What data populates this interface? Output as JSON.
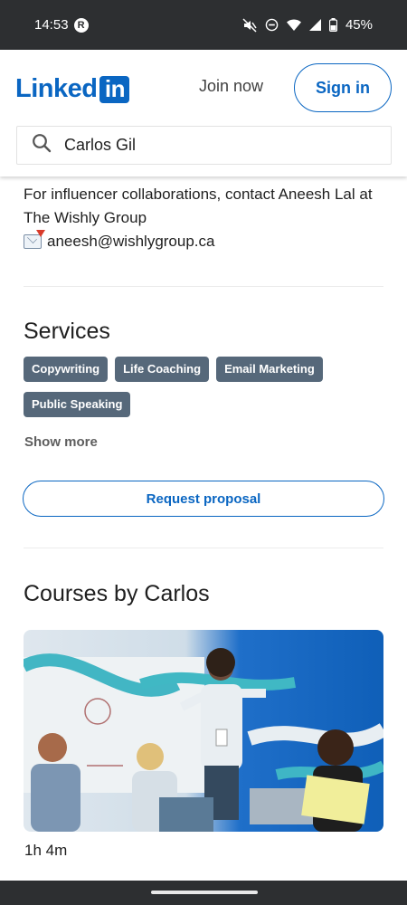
{
  "status_bar": {
    "time": "14:53",
    "badge": "R",
    "battery": "45%"
  },
  "header": {
    "logo_text": "Linked",
    "logo_badge": "in",
    "join_label": "Join now",
    "signin_label": "Sign in"
  },
  "search": {
    "value": "Carlos Gil",
    "icon": "search-icon"
  },
  "about": {
    "line1": "For influencer collaborations, contact Aneesh Lal at The Wishly Group",
    "email": "aneesh@wishlygroup.ca",
    "email_icon": "incoming-envelope-icon"
  },
  "services": {
    "title": "Services",
    "chips": [
      "Copywriting",
      "Life Coaching",
      "Email Marketing",
      "Public Speaking"
    ],
    "show_more": "Show more",
    "request_label": "Request proposal"
  },
  "courses": {
    "title": "Courses by Carlos",
    "items": [
      {
        "duration": "1h 4m"
      }
    ]
  },
  "colors": {
    "brand": "#0a66c2",
    "chip": "#56687a",
    "statusbar": "#2d2f31"
  }
}
